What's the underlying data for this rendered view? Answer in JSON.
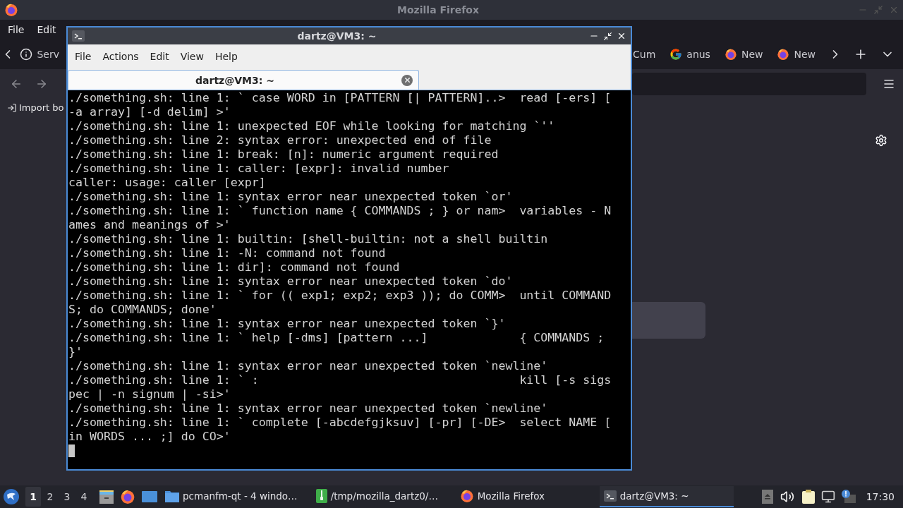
{
  "firefox": {
    "title": "Mozilla Firefox",
    "menu": [
      "File",
      "Edit"
    ],
    "tabs_left": [
      {
        "label": "Serv",
        "kind": "info"
      }
    ],
    "tabs_right": [
      {
        "label": "Cum"
      },
      {
        "label": "anus",
        "kind": "google"
      },
      {
        "label": "New",
        "kind": "firefox"
      },
      {
        "label": "New",
        "kind": "firefox"
      }
    ],
    "bookmarks": [
      {
        "label": "Import bo"
      }
    ]
  },
  "terminal": {
    "title": "dartz@VM3: ~",
    "menu": [
      "File",
      "Actions",
      "Edit",
      "View",
      "Help"
    ],
    "tabs": [
      {
        "label": "dartz@VM3: ~",
        "selected": true
      }
    ],
    "lines": [
      "./something.sh: line 1: ` case WORD in [PATTERN [| PATTERN]..>  read [-ers] [",
      "-a array] [-d delim] >'",
      "./something.sh: line 1: unexpected EOF while looking for matching `''",
      "./something.sh: line 2: syntax error: unexpected end of file",
      "./something.sh: line 1: break: [n]: numeric argument required",
      "./something.sh: line 1: caller: [expr]: invalid number",
      "caller: usage: caller [expr]",
      "./something.sh: line 1: syntax error near unexpected token `or'",
      "./something.sh: line 1: ` function name { COMMANDS ; } or nam>  variables - N",
      "ames and meanings of >'",
      "./something.sh: line 1: builtin: [shell-builtin: not a shell builtin",
      "./something.sh: line 1: -N: command not found",
      "./something.sh: line 1: dir]: command not found",
      "./something.sh: line 1: syntax error near unexpected token `do'",
      "./something.sh: line 1: ` for (( exp1; exp2; exp3 )); do COMM>  until COMMAND",
      "S; do COMMANDS; done'",
      "./something.sh: line 1: syntax error near unexpected token `}'",
      "./something.sh: line 1: ` help [-dms] [pattern ...]             { COMMANDS ;",
      "}'",
      "./something.sh: line 1: syntax error near unexpected token `newline'",
      "./something.sh: line 1: ` :                                     kill [-s sigs",
      "pec | -n signum | -si>'",
      "./something.sh: line 1: syntax error near unexpected token `newline'",
      "./something.sh: line 1: ` complete [-abcdefgjksuv] [-pr] [-DE>  select NAME [",
      "in WORDS ... ;] do CO>'"
    ]
  },
  "taskbar": {
    "desktops": [
      {
        "label": "1",
        "selected": true
      },
      {
        "label": "2",
        "selected": false
      },
      {
        "label": "3",
        "selected": false
      },
      {
        "label": "4",
        "selected": false
      }
    ],
    "tasks": [
      {
        "label": "pcmanfm-qt - 4 windo…",
        "kind": "folder",
        "selected": false
      },
      {
        "label": "/tmp/mozilla_dartz0/…",
        "kind": "archive",
        "selected": false
      },
      {
        "label": "Mozilla Firefox",
        "kind": "firefox",
        "selected": false
      },
      {
        "label": "dartz@VM3: ~",
        "kind": "terminal",
        "selected": true
      }
    ],
    "clock": "17:30"
  }
}
